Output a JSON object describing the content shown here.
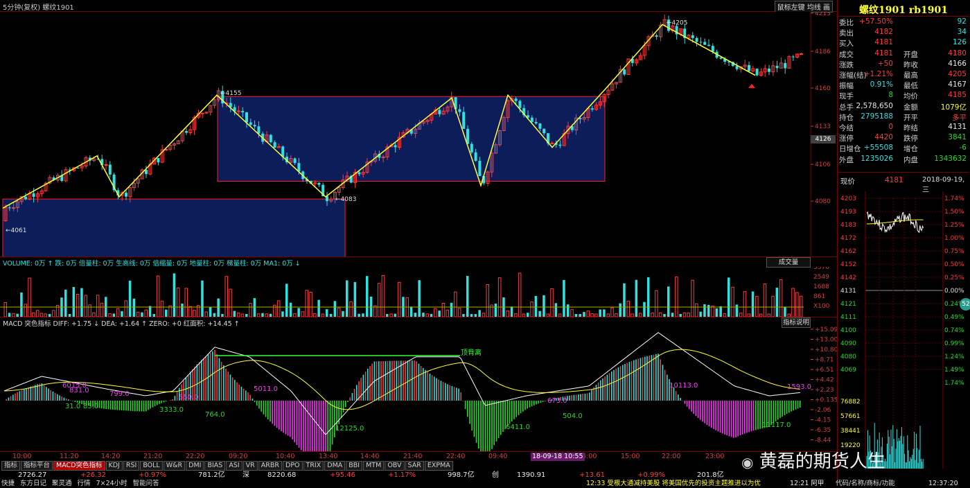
{
  "window": {
    "title": "5分钟(复权)  螺纹1901",
    "buttons": "鼠标左键  均线  画"
  },
  "main_chart": {
    "price_axis": [
      "4213",
      "4186",
      "4160",
      "4133",
      "4106",
      "4080"
    ],
    "current_price_tag": "4126",
    "annotations": {
      "high": "4205",
      "low": "4061",
      "mid_high": "4155",
      "mid_low": "4083"
    },
    "colors": {
      "up": "#ff3b3b",
      "down": "#33e0e0",
      "zigzag": "#ffff33",
      "box_fill": "#0c1d5a",
      "box_border": "#ff2020"
    }
  },
  "volume": {
    "header": "VOLUME: 0万 ↑  跌: 0万  倍量柱: 0万  生高线: 0万  倍缩量: 0万  地量柱: 0万  梯量柱: 0万  MA1: 0万 ↓",
    "button": "成交量",
    "axis": [
      "3376",
      "2549",
      "1688",
      "861",
      "X100"
    ],
    "marks": [
      "高",
      "倍"
    ]
  },
  "macd": {
    "header": "MACD 突色指标  DIFF: +1.75 ↓  DEA: +1.64 ↑  ZERO: +0  红面积: +14.45 ↑",
    "button": "指标说明",
    "axis": [
      "+15.09",
      "+13.00",
      "+10.80",
      "+8.71",
      "+6.51",
      "+4.42",
      "+2.23",
      "+0.135",
      "-2.06",
      "-4.15",
      "-6.35",
      "-8.44"
    ],
    "label_top": "顶背离",
    "area_labels": [
      "6015.0",
      "831.0",
      "799.0",
      "550.0",
      "5011.0",
      "31.0",
      "85.0",
      "3333.0",
      "764.0",
      "12125.0",
      "6411.0",
      "504.0",
      "10113.0",
      "1593.0",
      "11117.0",
      "673.0"
    ]
  },
  "time_axis": [
    "10:00",
    "11:20",
    "14:20",
    "21:20",
    "22:20",
    "09:20",
    "10:40",
    "13:40",
    "14:40",
    "21:40",
    "22:40",
    "09:40",
    "14:00",
    "15:00",
    "22:00",
    "23:00"
  ],
  "time_highlight": "18-09-18 10:55",
  "tabs": [
    "指标",
    "指标平台",
    "MACD突色指标",
    "KDJ",
    "RSI",
    "BOLL",
    "W&R",
    "DMI",
    "BIAS",
    "ASI",
    "VR",
    "ARBR",
    "DPO",
    "TRIX",
    "DMA",
    "BBI",
    "MTM",
    "OBV",
    "SAR",
    "EXPMA"
  ],
  "ticker": {
    "a": "2726.27",
    "b": "+26.32",
    "c": "+0.97%",
    "d": "781.2亿",
    "e": "深",
    "f": "8220.68",
    "g": "+95.46",
    "h": "+1.17%",
    "i": "998.7亿",
    "j": "创",
    "k": "1390.91",
    "l": "+13.61",
    "m": "+0.99%",
    "n": "201.8亿"
  },
  "status": {
    "items": [
      "快捷",
      "东方日记",
      "聚灵通",
      "行情",
      "7×24小时",
      "智能问答"
    ],
    "news": "12:33 受根大通减持美股 将美国优先的投资主题推进以为优",
    "time1": "12:21 阿甲",
    "links": "代码/名称/商标/功能",
    "clock": "12:37:20"
  },
  "side": {
    "title": "螺纹1901 rb1901",
    "rows": [
      {
        "l": "委比",
        "v": "+57.50%",
        "l2": "",
        "v2": "92"
      },
      {
        "l": "卖出",
        "v": "4182",
        "l2": "",
        "v2": "34"
      },
      {
        "l": "买入",
        "v": "4181",
        "l2": "",
        "v2": "126"
      },
      {
        "l": "成交",
        "v": "4181",
        "l2": "开盘",
        "v2": "4180"
      },
      {
        "l": "涨跌",
        "v": "+50",
        "l2": "昨收",
        "v2": "4166"
      },
      {
        "l": "涨幅(结)",
        "v": "+1.21%",
        "l2": "最高",
        "v2": "4205"
      },
      {
        "l": "振幅",
        "v": "0.91%",
        "l2": "最低",
        "v2": "4167"
      },
      {
        "l": "现手",
        "v": "8",
        "l2": "均价",
        "v2": "4185"
      },
      {
        "l": "总手",
        "v": "2,578,650",
        "l2": "金额",
        "v2": "1079亿"
      },
      {
        "l": "持仓",
        "v": "2795188",
        "l2": "开平",
        "v2": "多平"
      },
      {
        "l": "今结",
        "v": "0",
        "l2": "昨结",
        "v2": "4131"
      },
      {
        "l": "涨停",
        "v": "4420",
        "l2": "跌停",
        "v2": "3841"
      },
      {
        "l": "日增仓",
        "v": "+55508",
        "l2": "增仓",
        "v2": "-6"
      },
      {
        "l": "外盘",
        "v": "1235026",
        "l2": "内盘",
        "v2": "1343632"
      }
    ],
    "now_label": "现价",
    "now_value": "4181",
    "date": "2018-09-19,三",
    "mini_price_axis": [
      "4203",
      "4193",
      "4183",
      "4172",
      "4162",
      "4152",
      "4142",
      "4131",
      "4121",
      "4111",
      "4100",
      "4090",
      "4080",
      "4069"
    ],
    "mini_pct_axis": [
      "1.74%",
      "1.50%",
      "1.25%",
      "1.00%",
      "0.75%",
      "0.50%",
      "0.25%",
      "0.00%",
      "0.24%",
      "0.49%",
      "0.74%",
      "0.99%",
      "1.24%",
      "1.49%",
      "1.74%"
    ],
    "mini_vol_axis": [
      "76882",
      "57661",
      "38441",
      "19220"
    ],
    "round_badge": "52"
  },
  "watermark": "黄磊的期货人生"
}
